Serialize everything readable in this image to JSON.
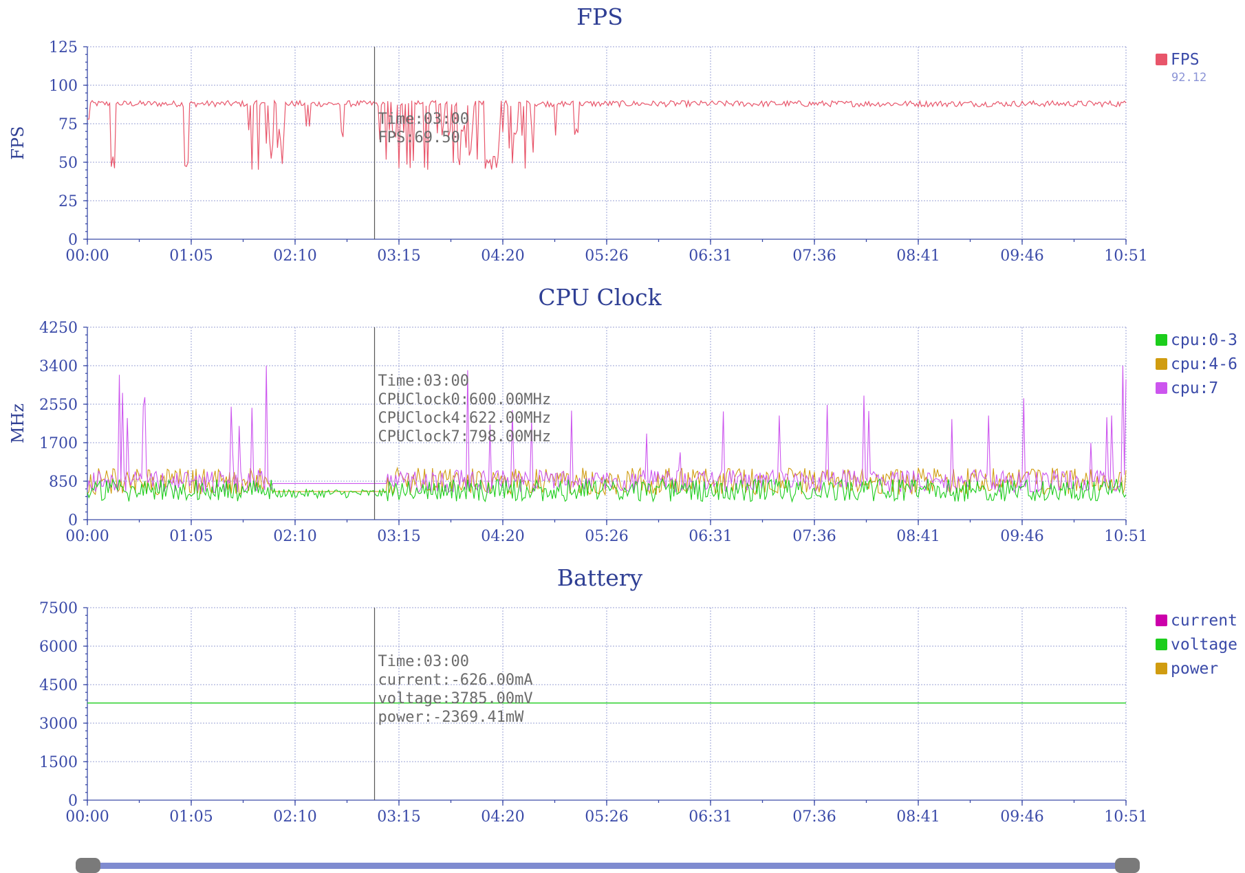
{
  "charts": [
    {
      "id": "fps",
      "title": "FPS",
      "ylabel": "FPS",
      "yticks": [
        "0",
        "25",
        "50",
        "75",
        "100",
        "125"
      ],
      "ymax": 125,
      "xticks": [
        "00:00",
        "01:05",
        "02:10",
        "03:15",
        "04:20",
        "05:26",
        "06:31",
        "07:36",
        "08:41",
        "09:46",
        "10:51"
      ],
      "legend": [
        {
          "label": "FPS",
          "color": "#e8556a",
          "sub": "92.12"
        }
      ],
      "tooltip": [
        "Time:03:00",
        "FPS:69.50"
      ]
    },
    {
      "id": "cpu",
      "title": "CPU Clock",
      "ylabel": "MHz",
      "yticks": [
        "0",
        "850",
        "1700",
        "2550",
        "3400",
        "4250"
      ],
      "ymax": 4250,
      "xticks": [
        "00:00",
        "01:05",
        "02:10",
        "03:15",
        "04:20",
        "05:26",
        "06:31",
        "07:36",
        "08:41",
        "09:46",
        "10:51"
      ],
      "legend": [
        {
          "label": "cpu:0-3",
          "color": "#1ccd1c"
        },
        {
          "label": "cpu:4-6",
          "color": "#d09c10"
        },
        {
          "label": "cpu:7",
          "color": "#cc55ee"
        }
      ],
      "tooltip": [
        "Time:03:00",
        "CPUClock0:600.00MHz",
        "CPUClock4:622.00MHz",
        "CPUClock7:798.00MHz"
      ]
    },
    {
      "id": "battery",
      "title": "Battery",
      "ylabel": "",
      "yticks": [
        "0",
        "1500",
        "3000",
        "4500",
        "6000",
        "7500"
      ],
      "ymax": 7500,
      "xticks": [
        "00:00",
        "01:05",
        "02:10",
        "03:15",
        "04:20",
        "05:26",
        "06:31",
        "07:36",
        "08:41",
        "09:46",
        "10:51"
      ],
      "legend": [
        {
          "label": "current",
          "color": "#cc00aa"
        },
        {
          "label": "voltage",
          "color": "#1ccd1c"
        },
        {
          "label": "power",
          "color": "#d09c10"
        }
      ],
      "tooltip": [
        "Time:03:00",
        "current:-626.00mA",
        "voltage:3785.00mV",
        "power:-2369.41mW"
      ]
    }
  ],
  "chart_data": [
    {
      "type": "line",
      "title": "FPS",
      "ylabel": "FPS",
      "x_range": [
        "00:00",
        "10:51"
      ],
      "ylim": [
        0,
        125
      ],
      "grid": true,
      "legend_placement": "right",
      "series": [
        {
          "name": "FPS",
          "values_summary": "~88-90 baseline with dips to ~45 between 00:10-04:00 and occasional dips to ~65-70 later",
          "cursor_value": 69.5
        }
      ]
    },
    {
      "type": "line",
      "title": "CPU Clock",
      "ylabel": "MHz",
      "x_range": [
        "00:00",
        "10:51"
      ],
      "ylim": [
        0,
        4250
      ],
      "grid": true,
      "legend_placement": "right",
      "series": [
        {
          "name": "cpu:0-3",
          "cursor_value": 600
        },
        {
          "name": "cpu:4-6",
          "cursor_value": 622
        },
        {
          "name": "cpu:7",
          "cursor_value": 798
        }
      ]
    },
    {
      "type": "line",
      "title": "Battery",
      "x_range": [
        "00:00",
        "10:51"
      ],
      "ylim": [
        0,
        7500
      ],
      "grid": true,
      "legend_placement": "right",
      "series": [
        {
          "name": "current",
          "cursor_value": -626
        },
        {
          "name": "voltage",
          "cursor_value": 3785
        },
        {
          "name": "power",
          "cursor_value": -2369.41
        }
      ]
    }
  ],
  "colors": {
    "axis": "#3a4aa8",
    "grid": "#9aa0d6",
    "fps": "#e8556a",
    "cpu03": "#1ccd1c",
    "cpu46": "#d09c10",
    "cpu7": "#cc55ee",
    "voltage": "#1ccd1c",
    "slider": "#7f8bd0",
    "handle": "#7a7a7a"
  }
}
